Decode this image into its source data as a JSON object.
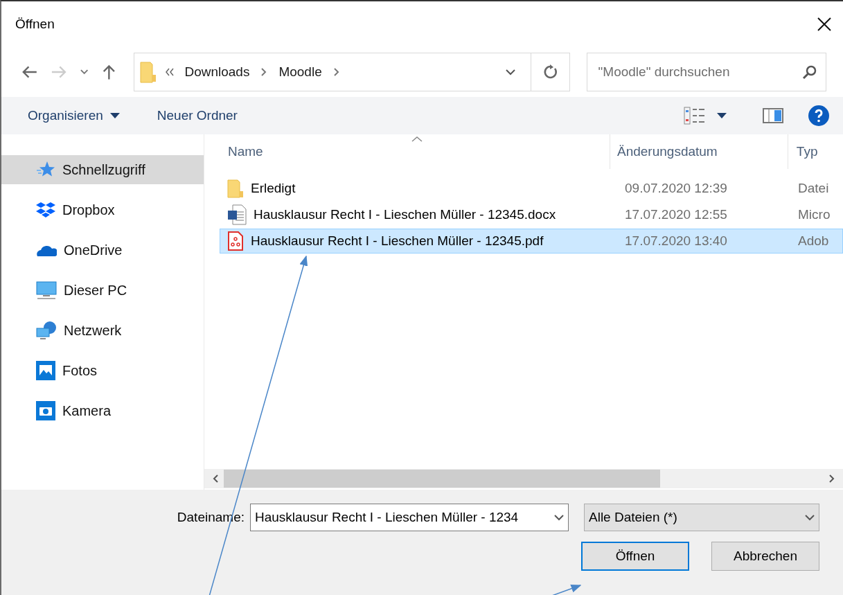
{
  "window": {
    "title": "Öffnen"
  },
  "address": {
    "breadcrumb": [
      "Downloads",
      "Moodle"
    ]
  },
  "search": {
    "placeholder": "\"Moodle\" durchsuchen"
  },
  "toolbar": {
    "organize": "Organisieren",
    "new_folder": "Neuer Ordner"
  },
  "sidebar": {
    "items": [
      {
        "label": "Schnellzugriff",
        "kind": "star",
        "selected": true
      },
      {
        "label": "Dropbox",
        "kind": "dropbox",
        "selected": false
      },
      {
        "label": "OneDrive",
        "kind": "cloud",
        "selected": false
      },
      {
        "label": "Dieser PC",
        "kind": "pc",
        "selected": false
      },
      {
        "label": "Netzwerk",
        "kind": "network",
        "selected": false
      },
      {
        "label": "Fotos",
        "kind": "photos",
        "selected": false
      },
      {
        "label": "Kamera",
        "kind": "camera",
        "selected": false
      }
    ]
  },
  "table": {
    "columns": [
      "Name",
      "Änderungsdatum",
      "Typ"
    ],
    "rows": [
      {
        "name": "Erledigt",
        "date": "09.07.2020 12:39",
        "type": "Datei",
        "kind": "folder",
        "selected": false
      },
      {
        "name": "Hausklausur Recht I - Lieschen Müller - 12345.docx",
        "date": "17.07.2020 12:55",
        "type": "Micro",
        "kind": "word",
        "selected": false
      },
      {
        "name": "Hausklausur Recht I - Lieschen Müller - 12345.pdf",
        "date": "17.07.2020 13:40",
        "type": "Adob",
        "kind": "pdf",
        "selected": true
      }
    ]
  },
  "filename": {
    "label": "Dateiname:",
    "value": "Hausklausur Recht I - Lieschen Müller - 1234"
  },
  "filetype": {
    "value": "Alle Dateien (*)"
  },
  "buttons": [
    {
      "label": "Öffnen",
      "focused": true
    },
    {
      "label": "Abbrechen",
      "focused": false
    }
  ]
}
